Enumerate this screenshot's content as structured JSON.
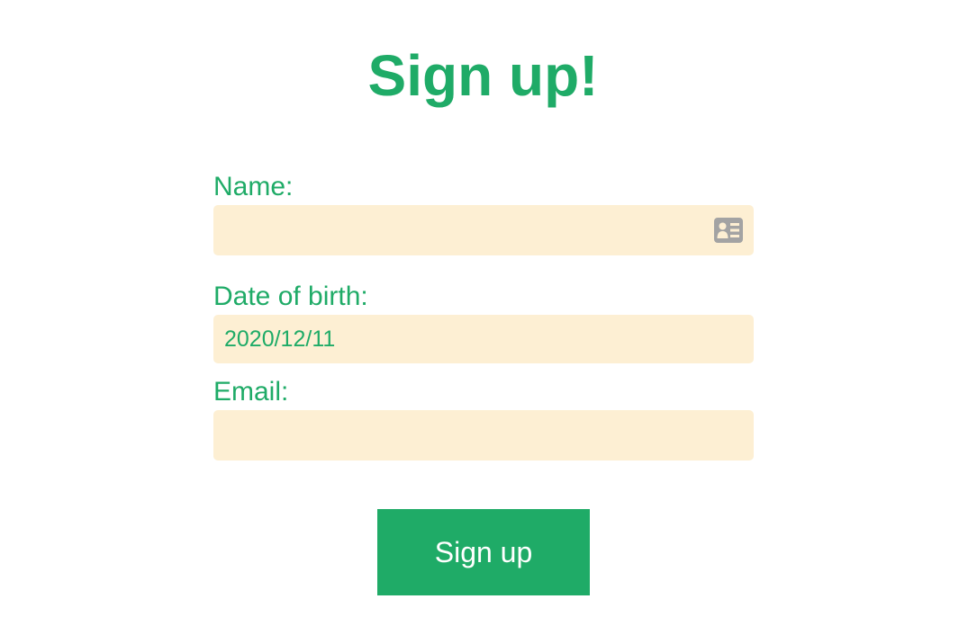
{
  "page": {
    "title": "Sign up!"
  },
  "form": {
    "name": {
      "label": "Name:",
      "value": "",
      "placeholder": ""
    },
    "dob": {
      "label": "Date of birth:",
      "value": "2020/12/11"
    },
    "email": {
      "label": "Email:",
      "value": "",
      "placeholder": ""
    },
    "submit_label": "Sign up"
  },
  "icons": {
    "name_field_icon": "contact-card-icon"
  },
  "colors": {
    "accent": "#1fab67",
    "field_bg": "#fdefd3",
    "icon_gray": "#a3a3a3",
    "button_text": "#ffffff"
  }
}
